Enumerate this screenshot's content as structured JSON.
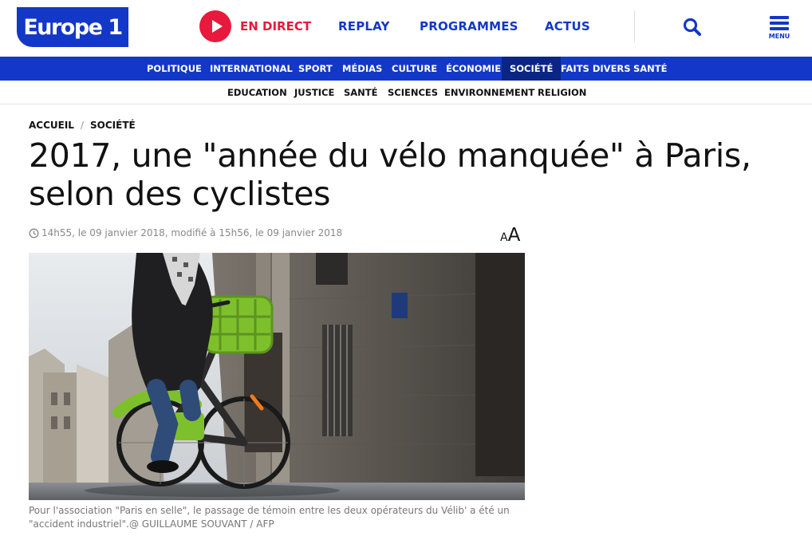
{
  "header": {
    "logo_text": "Europe 1",
    "live_label": "EN DIRECT",
    "nav": [
      "REPLAY",
      "PROGRAMMES",
      "ACTUS"
    ],
    "menu_label": "MENU",
    "brand_color": "#1338c7",
    "live_color": "#e8193c"
  },
  "categories": [
    "POLITIQUE",
    "INTERNATIONAL",
    "SPORT",
    "MÉDIAS",
    "CULTURE",
    "ÉCONOMIE",
    "SOCIÉTÉ",
    "FAITS DIVERS",
    "SANTÉ"
  ],
  "active_category": "SOCIÉTÉ",
  "subcategories": [
    "EDUCATION",
    "JUSTICE",
    "SANTÉ",
    "SCIENCES",
    "ENVIRONNEMENT",
    "RELIGION"
  ],
  "article": {
    "breadcrumb": [
      "ACCUEIL",
      "SOCIÉTÉ"
    ],
    "breadcrumb_sep": "/",
    "title": "2017, une \"année du vélo manquée\" à Paris, selon des cyclistes",
    "meta": "14h55, le 09 janvier 2018, modifié à 15h56, le 09 janvier 2018",
    "font_toggle_small": "A",
    "font_toggle_large": "A",
    "caption": "Pour l'association \"Paris en selle\", le passage de témoin entre les deux opérateurs du Vélib' a été un \"accident industriel\".@ GUILLAUME SOUVANT / AFP"
  }
}
